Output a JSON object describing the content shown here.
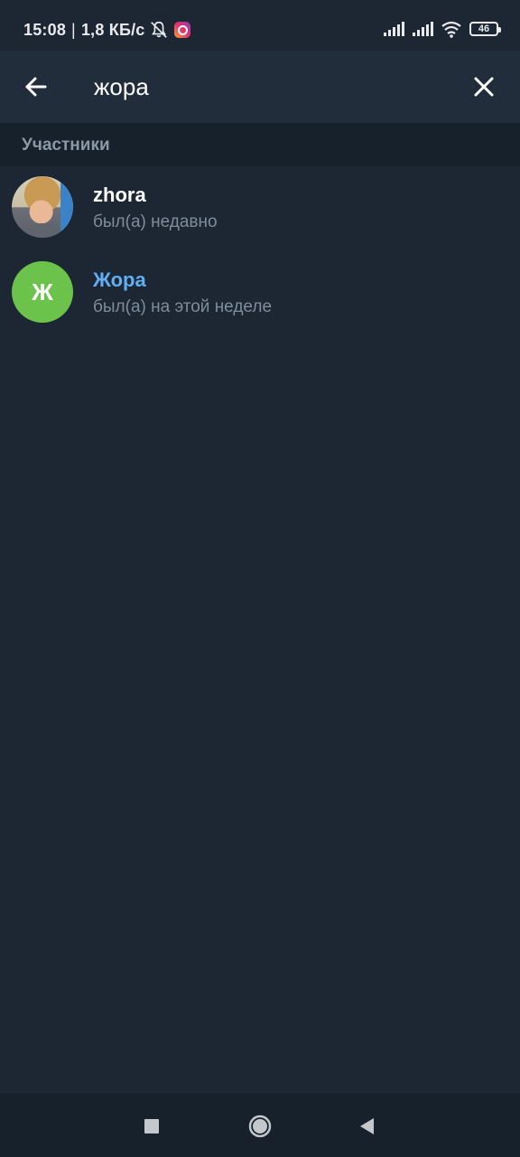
{
  "status_bar": {
    "time": "15:08",
    "separator": "|",
    "speed": "1,8 КБ/с",
    "battery": "46",
    "icons": [
      "mute-bell-icon",
      "instagram-icon",
      "signal-icon",
      "signal-icon",
      "wifi-icon",
      "battery-icon"
    ]
  },
  "header": {
    "back_icon": "arrow-left-icon",
    "search_value": "жора",
    "clear_icon": "close-icon"
  },
  "section": {
    "title": "Участники"
  },
  "results": [
    {
      "name": "zhora",
      "status": "был(а) недавно",
      "avatar": "photo"
    },
    {
      "name": "Жора",
      "status": "был(а) на этой неделе",
      "avatar_letter": "Ж",
      "avatar_color": "#6bc34b",
      "name_color": "#62aef3"
    }
  ],
  "nav": {
    "icons": [
      "square-icon",
      "circle-icon",
      "triangle-back-icon"
    ]
  },
  "colors": {
    "background": "#1d2733",
    "app_bar": "#212d3b",
    "section": "#17212b",
    "accent": "#62aef3"
  }
}
